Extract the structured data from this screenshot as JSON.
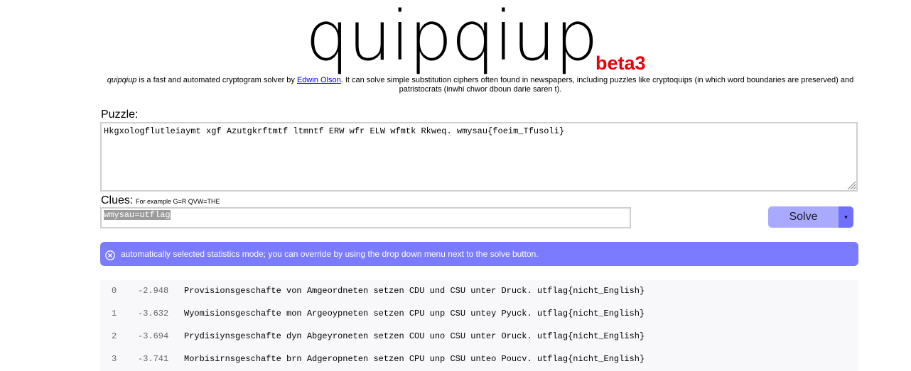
{
  "header": {
    "logo_text": "quipqiup",
    "beta_label": "beta3",
    "description_app": "quipqiup",
    "description_part1": " is a fast and automated cryptogram solver by ",
    "author_link": "Edwin Olson",
    "description_part2": ". It can solve simple substitution ciphers often found in newspapers, including puzzles like cryptoquips (in which word boundaries are preserved) and patristocrats (inwhi chwor dboun darie saren t)."
  },
  "puzzle": {
    "label": "Puzzle:",
    "value": "Hkgxologflutleiaymt xgf Azutgkrftmtf ltmntf ERW wfr ELW wfmtk Rkweq. wmysau{foeim_Tfusoli}"
  },
  "clues": {
    "label": "Clues:",
    "hint": "For example G=R QVW=THE",
    "value": "wmysau=utflag"
  },
  "solve": {
    "button_label": "Solve",
    "dropdown_glyph": "▾"
  },
  "alert": {
    "message": "automatically selected statistics mode; you can override by using the drop down menu next to the solve button."
  },
  "results": [
    {
      "index": "0",
      "score": "-2.948",
      "text": "Provisionsgeschafte von Amgeordneten setzen CDU und CSU unter Druck. utflag{nicht_English}"
    },
    {
      "index": "1",
      "score": "-3.632",
      "text": "Wyomisionsgeschafte mon Argeoypneten setzen CPU unp CSU untey Pyuck. utflag{nicht_English}"
    },
    {
      "index": "2",
      "score": "-3.694",
      "text": "Prydisiynsgeschafte dyn Abgeyroneten setzen COU uno CSU unter Oruck. utflag{nicht_English}"
    },
    {
      "index": "3",
      "score": "-3.741",
      "text": "Morbisirnsgeschafte brn Adgeropneten setzen CPU unp CSU unteo Poucv. utflag{nicht_English}"
    }
  ],
  "colors": {
    "beta": "#e8000b",
    "solve_button": "#a9a9ff",
    "solve_dropdown": "#7070ff",
    "alert_bg": "#7b7bff",
    "results_bg": "#f8f8fa"
  },
  "icons": {
    "alert_close": "close-circle-icon",
    "resize": "resize-grip-icon"
  }
}
